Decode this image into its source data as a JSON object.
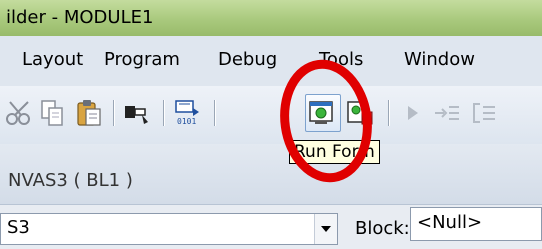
{
  "window": {
    "title": "ilder - MODULE1",
    "title_color": "#a9c97d"
  },
  "menu": {
    "items": [
      "Layout",
      "Program",
      "Debug",
      "Tools",
      "Window"
    ]
  },
  "toolbar": {
    "icons": [
      "cut-icon",
      "copy-icon",
      "paste-icon",
      "stamp-icon",
      "compile-icon",
      "run-form-icon",
      "debug-form-icon",
      "step-icon",
      "step-into-icon",
      "step-out-icon"
    ]
  },
  "tooltip": {
    "text": "Run Form"
  },
  "canvas": {
    "label": "NVAS3 ( BL1 )"
  },
  "item_combo": {
    "value": "S3"
  },
  "block": {
    "label": "Block:",
    "value": "<Null>"
  },
  "annotation": {
    "color": "#e00000"
  }
}
